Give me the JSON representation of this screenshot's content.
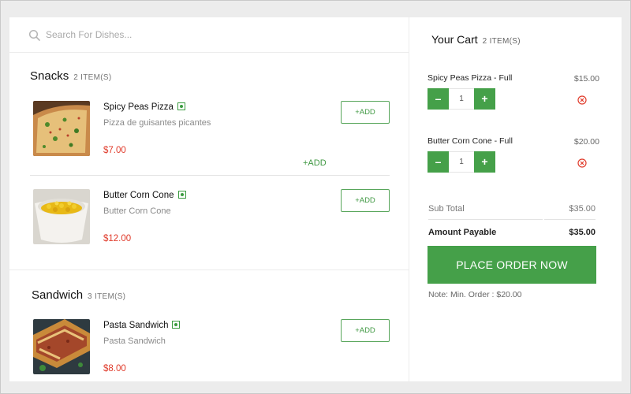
{
  "search": {
    "placeholder": "Search For Dishes..."
  },
  "sections": [
    {
      "title": "Snacks",
      "count": "2 ITEM(S)",
      "items": [
        {
          "name": "Spicy Peas Pizza",
          "desc": "Pizza de guisantes picantes",
          "price": "$7.00",
          "add_label": "+ADD"
        },
        {
          "name": "Butter Corn Cone",
          "desc": "Butter Corn Cone",
          "price": "$12.00",
          "add_label": "+ADD"
        }
      ],
      "extra_add_label": "+ADD"
    },
    {
      "title": "Sandwich",
      "count": "3 ITEM(S)",
      "items": [
        {
          "name": "Pasta Sandwich",
          "desc": "Pasta Sandwich",
          "price": "$8.00",
          "add_label": "+ADD"
        }
      ]
    }
  ],
  "cart": {
    "title": "Your Cart",
    "count": "2 ITEM(S)",
    "items": [
      {
        "name": "Spicy Peas Pizza - Full",
        "price": "$15.00",
        "qty": "1",
        "minus": "–",
        "plus": "+"
      },
      {
        "name": "Butter Corn Cone - Full",
        "price": "$20.00",
        "qty": "1",
        "minus": "–",
        "plus": "+"
      }
    ],
    "subtotal_label": "Sub Total",
    "subtotal_value": "$35.00",
    "payable_label": "Amount Payable",
    "payable_value": "$35.00",
    "place_order_label": "PLACE ORDER NOW",
    "note": "Note: Min. Order : $20.00"
  },
  "colors": {
    "accent": "#45a049",
    "price": "#e03a2a",
    "remove": "#e03a2a"
  },
  "icons": {
    "search": "search-icon",
    "veg": "veg-indicator-icon",
    "remove": "remove-icon"
  }
}
